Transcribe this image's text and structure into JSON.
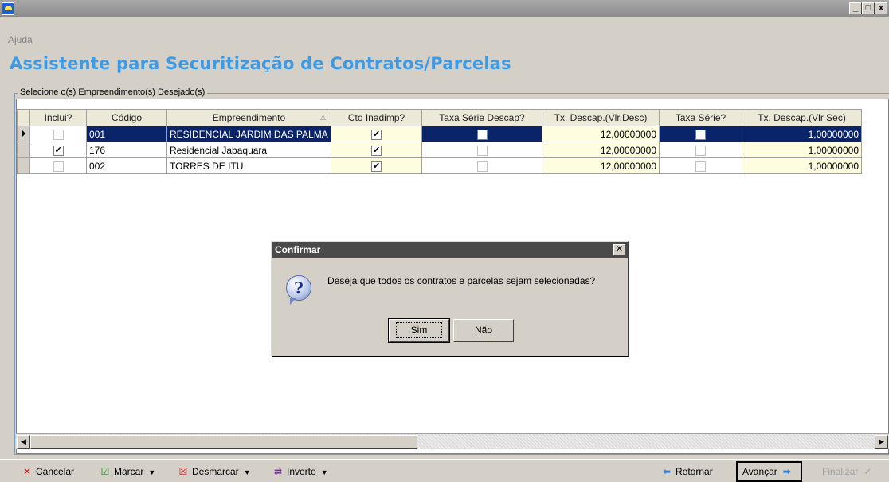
{
  "window": {
    "controls": [
      "_",
      "□",
      "x"
    ]
  },
  "menu": {
    "ajuda": "Ajuda"
  },
  "page": {
    "title": "Assistente para Securitização de Contratos/Parcelas"
  },
  "group": {
    "legend": "Selecione o(s) Empreendimento(s) Desejado(s)"
  },
  "grid": {
    "columns": [
      "Inclui?",
      "Código",
      "Empreendimento",
      "Cto Inadimp?",
      "Taxa Série Descap?",
      "Tx. Descap.(Vlr.Desc)",
      "Taxa Série?",
      "Tx. Descap.(Vlr Sec)"
    ],
    "rows": [
      {
        "inclui": false,
        "codigo": "001",
        "empreendimento": "RESIDENCIAL JARDIM DAS PALMA",
        "cto_inadimp": true,
        "taxa_serie_descap": false,
        "tx_descap_vlr_desc": "12,00000000",
        "taxa_serie": false,
        "tx_descap_vlr_sec": "1,00000000"
      },
      {
        "inclui": true,
        "codigo": "176",
        "empreendimento": "Residencial Jabaquara",
        "cto_inadimp": true,
        "taxa_serie_descap": false,
        "tx_descap_vlr_desc": "12,00000000",
        "taxa_serie": false,
        "tx_descap_vlr_sec": "1,00000000"
      },
      {
        "inclui": false,
        "codigo": "002",
        "empreendimento": "TORRES DE ITU",
        "cto_inadimp": true,
        "taxa_serie_descap": false,
        "tx_descap_vlr_desc": "12,00000000",
        "taxa_serie": false,
        "tx_descap_vlr_sec": "1,00000000"
      }
    ]
  },
  "toolbar": {
    "cancelar": "Cancelar",
    "marcar": "Marcar",
    "desmarcar": "Desmarcar",
    "inverte": "Inverte",
    "retornar": "Retornar",
    "avancar": "Avançar",
    "finalizar": "Finalizar"
  },
  "dialog": {
    "title": "Confirmar",
    "message": "Deseja que todos os contratos e parcelas sejam selecionadas?",
    "yes": "Sim",
    "no": "Não"
  },
  "colors": {
    "title": "#3c9ae6",
    "selection": "#0a246a",
    "highlight_cell": "#fffde0"
  }
}
